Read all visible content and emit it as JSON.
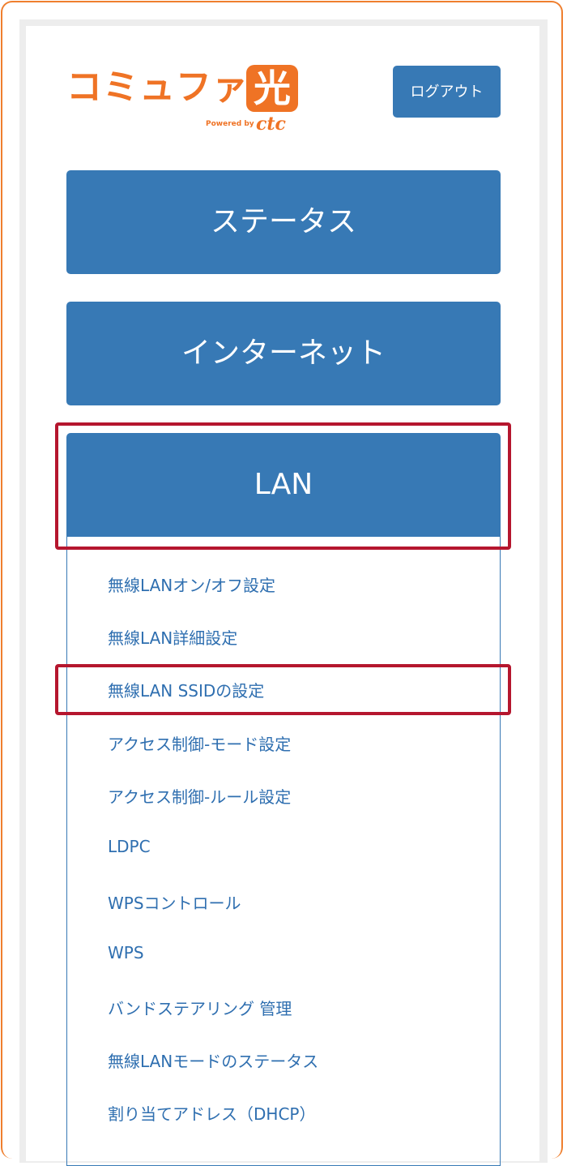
{
  "logo": {
    "brand": "コミュファ",
    "kanji": "光",
    "powered": "Powered by",
    "ctc": "ctc"
  },
  "header": {
    "logout_label": "ログアウト"
  },
  "menu": {
    "status_label": "ステータス",
    "internet_label": "インターネット",
    "lan_label": "LAN"
  },
  "lan_submenu": [
    "無線LANオン/オフ設定",
    "無線LAN詳細設定",
    "無線LAN SSIDの設定",
    "アクセス制御-モード設定",
    "アクセス制御-ルール設定",
    "LDPC",
    "WPSコントロール",
    "WPS",
    "バンドステアリング 管理",
    "無線LANモードのステータス",
    "割り当てアドレス（DHCP）"
  ],
  "colors": {
    "brand_orange": "#ef7325",
    "button_blue": "#3779b5",
    "link_blue": "#2f6fb0",
    "highlight_red": "#b5162e"
  }
}
